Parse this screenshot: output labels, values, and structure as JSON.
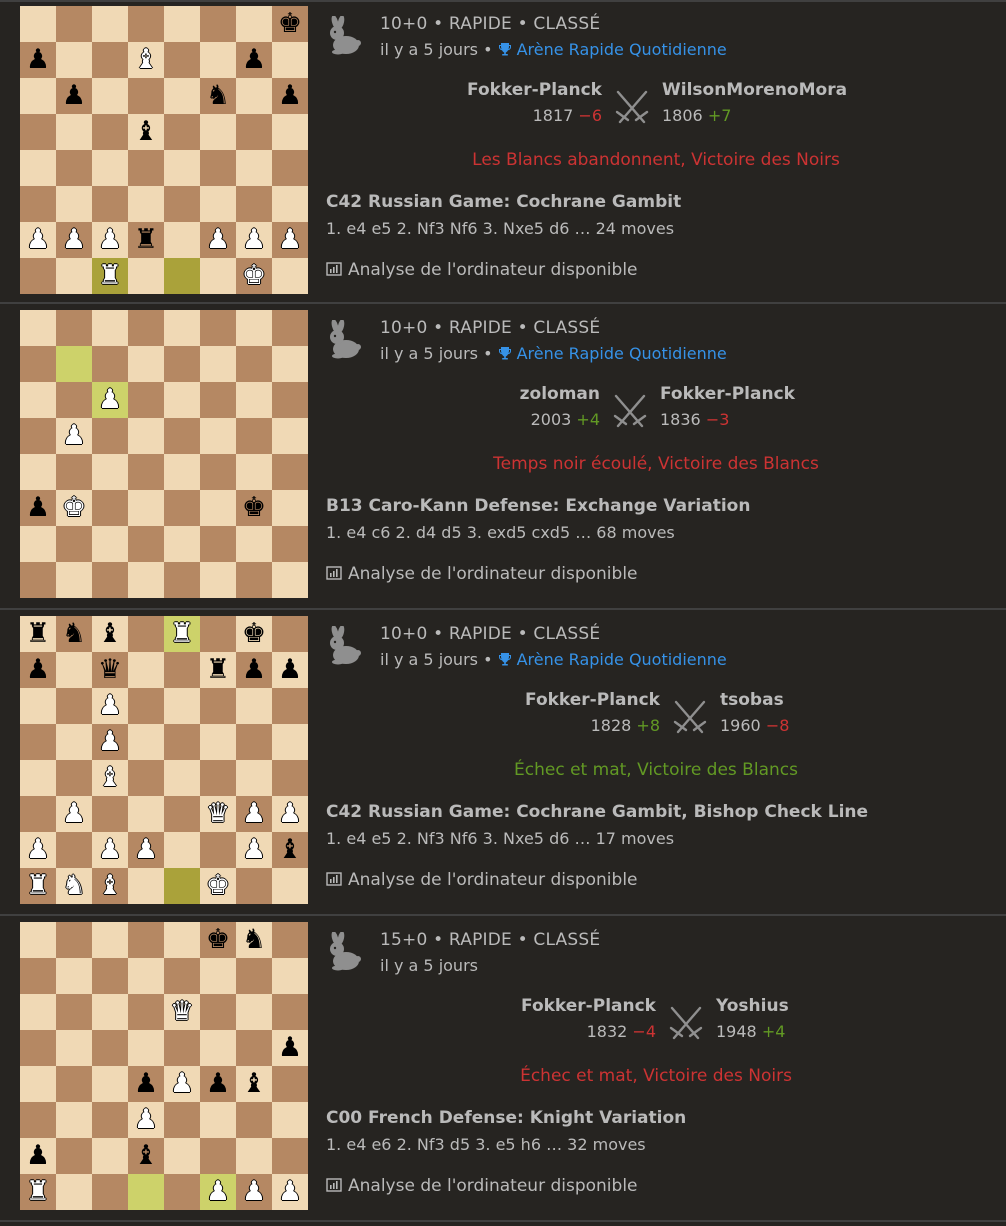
{
  "games": [
    {
      "header": "10+0 • RAPIDE • CLASSÉ",
      "time_ago": "il y a 5 jours",
      "separator": " • ",
      "tournament": "Arène Rapide Quotidienne",
      "white": {
        "name": "Fokker-Planck",
        "rating": "1817",
        "diff": "−6",
        "diff_sign": "neg"
      },
      "black": {
        "name": "WilsonMorenoMora",
        "rating": "1806",
        "diff": "+7",
        "diff_sign": "pos"
      },
      "result": "Les Blancs abandonnent, Victoire des Noirs",
      "result_type": "loss",
      "opening": "C42 Russian Game: Cochrane Gambit",
      "moves": "1. e4 e5 2. Nf3 Nf6 3. Nxe5 d6 … 24 moves",
      "analysis": "Analyse de l'ordinateur disponible",
      "board": [
        "       k",
        "p  B  p ",
        " p   n p",
        "   b    ",
        "        ",
        "        ",
        "PPPr PPP",
        "  R   K "
      ],
      "highlights": [
        [
          7,
          2
        ],
        [
          7,
          4
        ]
      ]
    },
    {
      "header": "10+0 • RAPIDE • CLASSÉ",
      "time_ago": "il y a 5 jours",
      "separator": " • ",
      "tournament": "Arène Rapide Quotidienne",
      "white": {
        "name": "zoloman",
        "rating": "2003",
        "diff": "+4",
        "diff_sign": "pos"
      },
      "black": {
        "name": "Fokker-Planck",
        "rating": "1836",
        "diff": "−3",
        "diff_sign": "neg"
      },
      "result": "Temps noir écoulé, Victoire des Blancs",
      "result_type": "loss",
      "opening": "B13 Caro-Kann Defense: Exchange Variation",
      "moves": "1. e4 c6 2. d4 d5 3. exd5 cxd5 … 68 moves",
      "analysis": "Analyse de l'ordinateur disponible",
      "board": [
        "        ",
        "        ",
        "  P     ",
        " P      ",
        "        ",
        "pK    k ",
        "        ",
        "        "
      ],
      "highlights": [
        [
          1,
          1
        ],
        [
          2,
          2
        ]
      ]
    },
    {
      "header": "10+0 • RAPIDE • CLASSÉ",
      "time_ago": "il y a 5 jours",
      "separator": " • ",
      "tournament": "Arène Rapide Quotidienne",
      "white": {
        "name": "Fokker-Planck",
        "rating": "1828",
        "diff": "+8",
        "diff_sign": "pos"
      },
      "black": {
        "name": "tsobas",
        "rating": "1960",
        "diff": "−8",
        "diff_sign": "neg"
      },
      "result": "Échec et mat, Victoire des Blancs",
      "result_type": "win",
      "opening": "C42 Russian Game: Cochrane Gambit, Bishop Check Line",
      "moves": "1. e4 e5 2. Nf3 Nf6 3. Nxe5 d6 … 17 moves",
      "analysis": "Analyse de l'ordinateur disponible",
      "board": [
        "rnb R k ",
        "p q  rpp",
        "  P     ",
        "  P     ",
        "  B     ",
        " P   QPP",
        "P PP  Pb",
        "RNB  K  "
      ],
      "highlights": [
        [
          0,
          4
        ],
        [
          7,
          4
        ]
      ]
    },
    {
      "header": "15+0 • RAPIDE • CLASSÉ",
      "time_ago": "il y a 5 jours",
      "separator": "",
      "tournament": "",
      "white": {
        "name": "Fokker-Planck",
        "rating": "1832",
        "diff": "−4",
        "diff_sign": "neg"
      },
      "black": {
        "name": "Yoshius",
        "rating": "1948",
        "diff": "+4",
        "diff_sign": "pos"
      },
      "result": "Échec et mat, Victoire des Noirs",
      "result_type": "loss",
      "opening": "C00 French Defense: Knight Variation",
      "moves": "1. e4 e6 2. Nf3 d5 3. e5 h6 … 32 moves",
      "analysis": "Analyse de l'ordinateur disponible",
      "board": [
        "     kn ",
        "        ",
        "    Q   ",
        "       p",
        "   pPpb ",
        "   P    ",
        "p  b    ",
        "R    PPP",
        "N   qK  "
      ],
      "highlights": [
        [
          7,
          3
        ],
        [
          7,
          5
        ]
      ]
    }
  ],
  "icons": {
    "variant": "rabbit-icon",
    "versus": "crossed-swords-icon",
    "tournament": "trophy-icon",
    "analysis": "bar-chart-icon"
  },
  "colors": {
    "background": "#262421",
    "light_square": "#f0d9b5",
    "dark_square": "#b58863",
    "highlight_light": "#cdd26a",
    "highlight_dark": "#aaa23a",
    "link": "#3692e7",
    "loss": "#cc3333",
    "win": "#629924"
  }
}
